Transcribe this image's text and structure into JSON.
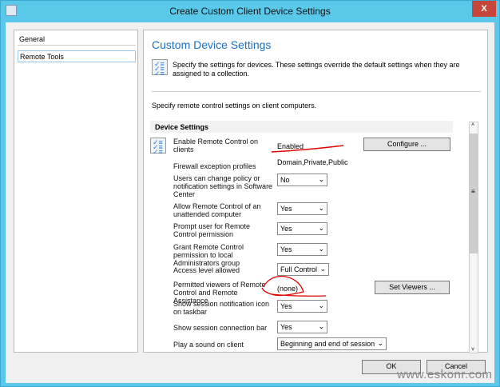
{
  "window": {
    "title": "Create Custom Client Device Settings",
    "close": "X"
  },
  "nav": [
    {
      "label": "General"
    },
    {
      "label": "Remote Tools"
    }
  ],
  "main": {
    "heading": "Custom Device Settings",
    "description": "Specify the settings for devices. These settings override the default settings when they are assigned to a collection.",
    "intro": "Specify remote control settings on client computers.",
    "section": "Device Settings",
    "rows": {
      "enable": {
        "label": "Enable Remote Control on clients",
        "value": "Enabled",
        "button": "Configure ..."
      },
      "firewall": {
        "label": "Firewall exception profiles",
        "value": "Domain,Private,Public"
      },
      "users_change": {
        "label": "Users can change policy or notification settings in Software Center",
        "value": "No"
      },
      "unattended": {
        "label": "Allow Remote Control of an unattended computer",
        "value": "Yes"
      },
      "prompt": {
        "label": "Prompt user for Remote Control permission",
        "value": "Yes"
      },
      "grant": {
        "label": "Grant Remote Control permission to local Administrators group",
        "value": "Yes"
      },
      "access": {
        "label": "Access level allowed",
        "value": "Full Control"
      },
      "viewers": {
        "label": "Permitted viewers of Remote Control and Remote Assistance",
        "value": "(none)",
        "button": "Set Viewers ..."
      },
      "notif_icon": {
        "label": "Show session notification icon on taskbar",
        "value": "Yes"
      },
      "conn_bar": {
        "label": "Show session connection bar",
        "value": "Yes"
      },
      "sound": {
        "label": "Play a sound on client",
        "value": "Beginning and end of session"
      }
    }
  },
  "footer": {
    "ok": "OK",
    "cancel": "Cancel"
  },
  "watermark": "www.eskonr.com",
  "colors": {
    "titlebar": "#5ac8e8",
    "heading": "#1a6fc4",
    "annotation": "#e00000",
    "close": "#c7463c"
  }
}
